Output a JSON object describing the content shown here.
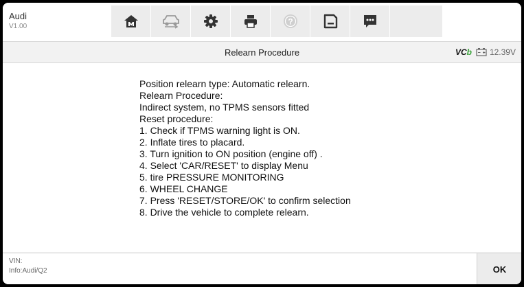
{
  "header": {
    "make": "Audi",
    "version": "V1.00",
    "buttons": [
      {
        "icon": "home-icon"
      },
      {
        "icon": "vehicle-swap-icon"
      },
      {
        "icon": "gear-icon"
      },
      {
        "icon": "print-icon"
      },
      {
        "icon": "help-icon"
      },
      {
        "icon": "save-icon"
      },
      {
        "icon": "message-icon"
      }
    ]
  },
  "subheader": {
    "title": "Relearn Procedure",
    "vci": "VC",
    "voltage": "12.39V"
  },
  "content": {
    "lines": [
      "Position relearn type: Automatic relearn.",
      "Relearn Procedure:",
      "Indirect system, no TPMS sensors fitted",
      "Reset procedure:",
      "1. Check if TPMS warning light is ON.",
      "2. Inflate tires to placard.",
      "3. Turn ignition to ON position (engine off) .",
      "4. Select 'CAR/RESET' to display Menu",
      "5. tire PRESSURE MONITORING",
      "6. WHEEL CHANGE",
      "7. Press 'RESET/STORE/OK' to confirm selection",
      "8. Drive the vehicle to complete relearn."
    ]
  },
  "footer": {
    "vin": "VIN:",
    "info": "Info:Audi/Q2",
    "ok_label": "OK"
  },
  "colors": {
    "toolbar_button_bg": "#ececec",
    "icon": "#333333",
    "vci_accent": "#3aa33a"
  }
}
